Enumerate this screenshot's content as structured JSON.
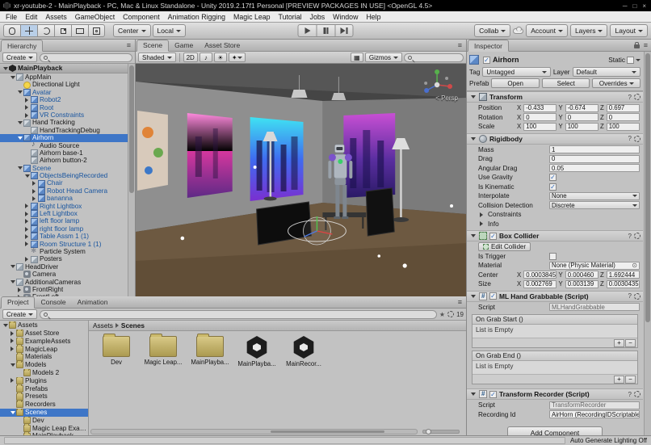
{
  "window": {
    "title": "xr-youtube-2 - MainPlayback - PC, Mac & Linux Standalone - Unity 2019.2.17f1 Personal [PREVIEW PACKAGES IN USE] <OpenGL 4.5>"
  },
  "menu": {
    "items": [
      "File",
      "Edit",
      "Assets",
      "GameObject",
      "Component",
      "Animation Rigging",
      "Magic Leap",
      "Tutorial",
      "Jobs",
      "Window",
      "Help"
    ]
  },
  "toolbar": {
    "center_label": "Center",
    "local_label": "Local",
    "collab_label": "Collab",
    "account_label": "Account",
    "layers_label": "Layers",
    "layout_label": "Layout"
  },
  "hierarchy": {
    "tab_label": "Hierarchy",
    "create_label": "Create",
    "items": [
      {
        "label": "MainPlayback",
        "depth": 0,
        "arrow": "d",
        "icon": "unity",
        "style": "scene-header"
      },
      {
        "label": "AppMain",
        "depth": 1,
        "arrow": "d",
        "icon": "cube",
        "style": "normal"
      },
      {
        "label": "Directional Light",
        "depth": 2,
        "arrow": "",
        "icon": "light",
        "style": "normal"
      },
      {
        "label": "Avatar",
        "depth": 2,
        "arrow": "d",
        "icon": "cube-blue",
        "style": "prefab"
      },
      {
        "label": "Robot2",
        "depth": 3,
        "arrow": "r",
        "icon": "cube-blue",
        "style": "prefab"
      },
      {
        "label": "Root",
        "depth": 3,
        "arrow": "r",
        "icon": "cube-blue",
        "style": "prefab"
      },
      {
        "label": "VR Constraints",
        "depth": 3,
        "arrow": "r",
        "icon": "cube-blue",
        "style": "prefab"
      },
      {
        "label": "Hand Tracking",
        "depth": 2,
        "arrow": "d",
        "icon": "cube",
        "style": "normal"
      },
      {
        "label": "HandTrackingDebug",
        "depth": 3,
        "arrow": "",
        "icon": "cube",
        "style": "normal"
      },
      {
        "label": "Airhorn",
        "depth": 2,
        "arrow": "d",
        "icon": "cube-blue",
        "style": "selected"
      },
      {
        "label": "Audio Source",
        "depth": 3,
        "arrow": "",
        "icon": "audio",
        "style": "normal"
      },
      {
        "label": "Airhorn base-1",
        "depth": 3,
        "arrow": "",
        "icon": "cube",
        "style": "normal"
      },
      {
        "label": "Airhorn button-2",
        "depth": 3,
        "arrow": "",
        "icon": "cube",
        "style": "normal"
      },
      {
        "label": "Scene",
        "depth": 2,
        "arrow": "d",
        "icon": "cube-blue",
        "style": "prefab"
      },
      {
        "label": "ObjectsBeingRecorded",
        "depth": 3,
        "arrow": "d",
        "icon": "cube-blue",
        "style": "prefab"
      },
      {
        "label": "Chair",
        "depth": 4,
        "arrow": "r",
        "icon": "cube-blue",
        "style": "prefab"
      },
      {
        "label": "Robot Head Camera",
        "depth": 4,
        "arrow": "r",
        "icon": "cube-blue",
        "style": "prefab"
      },
      {
        "label": "bananna",
        "depth": 4,
        "arrow": "r",
        "icon": "cube-blue",
        "style": "prefab"
      },
      {
        "label": "Right Lightbox",
        "depth": 3,
        "arrow": "r",
        "icon": "cube-blue",
        "style": "prefab"
      },
      {
        "label": "Left Lightbox",
        "depth": 3,
        "arrow": "r",
        "icon": "cube-blue",
        "style": "prefab"
      },
      {
        "label": "left floor lamp",
        "depth": 3,
        "arrow": "r",
        "icon": "cube-blue",
        "style": "prefab"
      },
      {
        "label": "right floor lamp",
        "depth": 3,
        "arrow": "r",
        "icon": "cube-blue",
        "style": "prefab"
      },
      {
        "label": "Table Assm 1 (1)",
        "depth": 3,
        "arrow": "r",
        "icon": "cube-blue",
        "style": "prefab"
      },
      {
        "label": "Room Structure 1 (1)",
        "depth": 3,
        "arrow": "r",
        "icon": "cube-blue",
        "style": "prefab"
      },
      {
        "label": "Particle System",
        "depth": 3,
        "arrow": "",
        "icon": "particle",
        "style": "normal"
      },
      {
        "label": "Posters",
        "depth": 3,
        "arrow": "r",
        "icon": "cube",
        "style": "normal"
      },
      {
        "label": "HeadDriver",
        "depth": 1,
        "arrow": "d",
        "icon": "cube",
        "style": "normal"
      },
      {
        "label": "Camera",
        "depth": 2,
        "arrow": "",
        "icon": "camera",
        "style": "normal"
      },
      {
        "label": "AdditionalCameras",
        "depth": 1,
        "arrow": "d",
        "icon": "cube",
        "style": "normal"
      },
      {
        "label": "FrontRight",
        "depth": 2,
        "arrow": "r",
        "icon": "camera",
        "style": "normal"
      },
      {
        "label": "FrontLeft",
        "depth": 2,
        "arrow": "r",
        "icon": "camera",
        "style": "normal"
      }
    ]
  },
  "scene": {
    "tabs": [
      "Scene",
      "Game",
      "Asset Store"
    ],
    "shaded_label": "Shaded",
    "mode_2d": "2D",
    "gizmos_label": "Gizmos",
    "persp_label": "< Persp"
  },
  "project": {
    "tabs": [
      "Project",
      "Console",
      "Animation"
    ],
    "create_label": "Create",
    "hidden_count": "19",
    "breadcrumb": {
      "root": "Assets",
      "current": "Scenes"
    },
    "tree": [
      {
        "label": "Assets",
        "depth": 0,
        "arrow": "d",
        "style": "normal"
      },
      {
        "label": "Asset Store",
        "depth": 1,
        "arrow": "r",
        "style": "normal"
      },
      {
        "label": "ExampleAssets",
        "depth": 1,
        "arrow": "r",
        "style": "normal"
      },
      {
        "label": "MagicLeap",
        "depth": 1,
        "arrow": "r",
        "style": "normal"
      },
      {
        "label": "Materials",
        "depth": 1,
        "arrow": "",
        "style": "normal"
      },
      {
        "label": "Models",
        "depth": 1,
        "arrow": "d",
        "style": "normal"
      },
      {
        "label": "Models 2",
        "depth": 2,
        "arrow": "",
        "style": "normal"
      },
      {
        "label": "Plugins",
        "depth": 1,
        "arrow": "r",
        "style": "normal"
      },
      {
        "label": "Prefabs",
        "depth": 1,
        "arrow": "",
        "style": "normal"
      },
      {
        "label": "Presets",
        "depth": 1,
        "arrow": "",
        "style": "normal"
      },
      {
        "label": "Recorders",
        "depth": 1,
        "arrow": "",
        "style": "normal"
      },
      {
        "label": "Scenes",
        "depth": 1,
        "arrow": "d",
        "style": "selected"
      },
      {
        "label": "Dev",
        "depth": 2,
        "arrow": "",
        "style": "normal"
      },
      {
        "label": "Magic Leap Examples",
        "depth": 2,
        "arrow": "",
        "style": "normal"
      },
      {
        "label": "MainPlayback",
        "depth": 2,
        "arrow": "",
        "style": "normal"
      }
    ],
    "grid": [
      {
        "label": "Dev",
        "kind": "folder"
      },
      {
        "label": "Magic Leap...",
        "kind": "folder"
      },
      {
        "label": "MainPlayba...",
        "kind": "folder"
      },
      {
        "label": "MainPlayba...",
        "kind": "unity"
      },
      {
        "label": "MainRecor...",
        "kind": "unity"
      }
    ]
  },
  "inspector": {
    "tab_label": "Inspector",
    "name": "Airhorn",
    "static_label": "Static",
    "tag_label": "Tag",
    "tag_value": "Untagged",
    "layer_label": "Layer",
    "layer_value": "Default",
    "prefab_label": "Prefab",
    "prefab_open": "Open",
    "prefab_select": "Select",
    "prefab_overrides": "Overrides",
    "add_component": "Add Component",
    "components": [
      {
        "title": "Transform",
        "icon": "transform",
        "toggle": false,
        "rows": [
          {
            "t": "vec",
            "label": "Position",
            "x": "-0.433",
            "y": "-0.674",
            "z": "0.697"
          },
          {
            "t": "vec",
            "label": "Rotation",
            "x": "0",
            "y": "0",
            "z": "0"
          },
          {
            "t": "vec",
            "label": "Scale",
            "x": "100",
            "y": "100",
            "z": "100"
          }
        ]
      },
      {
        "title": "Rigidbody",
        "icon": "rigidbody",
        "toggle": false,
        "rows": [
          {
            "t": "field",
            "label": "Mass",
            "value": "1"
          },
          {
            "t": "field",
            "label": "Drag",
            "value": "0"
          },
          {
            "t": "field",
            "label": "Angular Drag",
            "value": "0.05"
          },
          {
            "t": "check",
            "label": "Use Gravity",
            "checked": true
          },
          {
            "t": "check",
            "label": "Is Kinematic",
            "checked": true
          },
          {
            "t": "drop",
            "label": "Interpolate",
            "value": "None"
          },
          {
            "t": "drop",
            "label": "Collision Detection",
            "value": "Discrete"
          },
          {
            "t": "fold",
            "label": "Constraints"
          },
          {
            "t": "fold",
            "label": "Info"
          }
        ]
      },
      {
        "title": "Box Collider",
        "icon": "collider",
        "toggle": true,
        "rows": [
          {
            "t": "editbtn",
            "label": "Edit Collider"
          },
          {
            "t": "check",
            "label": "Is Trigger",
            "checked": false
          },
          {
            "t": "obj",
            "label": "Material",
            "value": "None (Physic Material)"
          },
          {
            "t": "vec",
            "label": "Center",
            "x": "0.0003845",
            "y": "0.000460",
            "z": "1.692444"
          },
          {
            "t": "vec",
            "label": "Size",
            "x": "0.002769",
            "y": "0.003139",
            "z": "0.0030435"
          }
        ]
      },
      {
        "title": "ML Hand Grabbable (Script)",
        "icon": "script",
        "toggle": true,
        "rows": [
          {
            "t": "script",
            "label": "Script",
            "value": "MLHandGrabbable"
          },
          {
            "t": "event",
            "label": "On Grab Start ()",
            "empty": "List is Empty"
          },
          {
            "t": "event",
            "label": "On Grab End ()",
            "empty": "List is Empty"
          }
        ]
      },
      {
        "title": "Transform Recorder (Script)",
        "icon": "script",
        "toggle": true,
        "rows": [
          {
            "t": "script",
            "label": "Script",
            "value": "TransformRecorder"
          },
          {
            "t": "obj",
            "label": "Recording Id",
            "value": "AirHorn (RecordingIDScriptable)"
          }
        ]
      }
    ]
  },
  "statusbar": {
    "right_label": "Auto Generate Lighting Off"
  }
}
